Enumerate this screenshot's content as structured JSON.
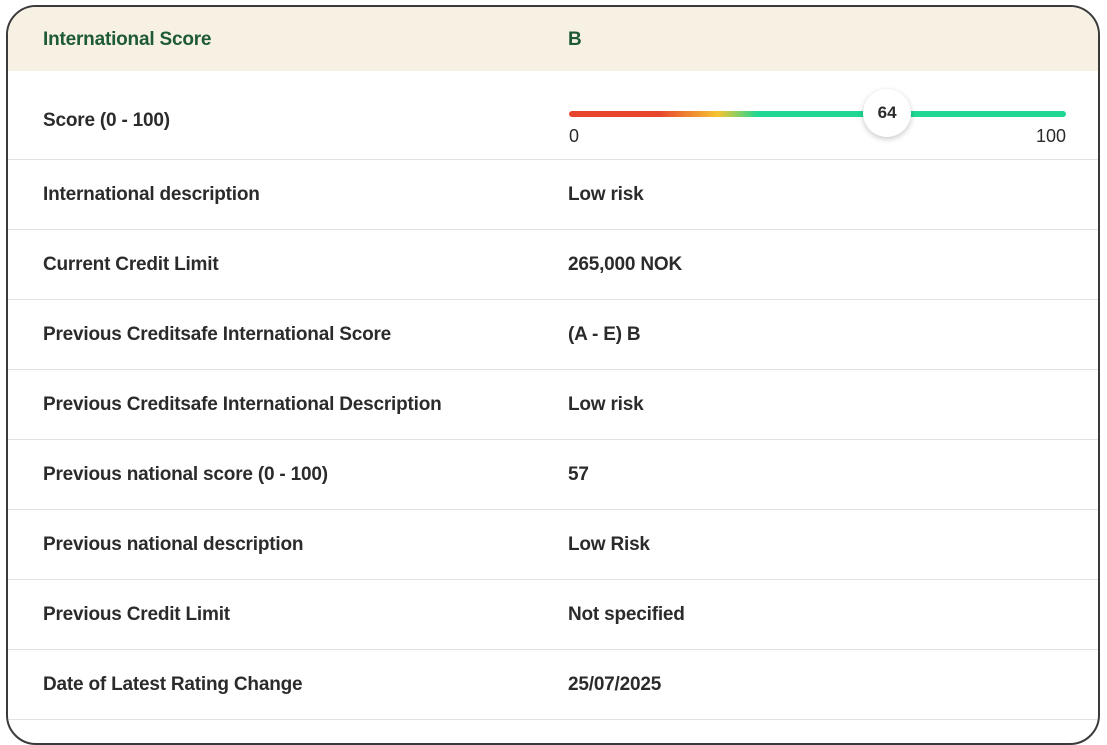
{
  "header": {
    "label": "International Score",
    "value": "B"
  },
  "score": {
    "label": "Score (0 - 100)",
    "value": 64,
    "value_text": "64",
    "min_label": "0",
    "max_label": "100",
    "min": 0,
    "max": 100,
    "gradient_colors": [
      "#e8452f",
      "#f5c431",
      "#1ed893"
    ]
  },
  "rows": [
    {
      "label": "International description",
      "value": "Low risk"
    },
    {
      "label": "Current Credit Limit",
      "value": "265,000 NOK"
    },
    {
      "label": "Previous Creditsafe International Score",
      "value": "(A - E) B"
    },
    {
      "label": "Previous Creditsafe International Description",
      "value": "Low risk"
    },
    {
      "label": "Previous national score (0 - 100)",
      "value": "57"
    },
    {
      "label": "Previous national description",
      "value": "Low Risk"
    },
    {
      "label": "Previous Credit Limit",
      "value": "Not specified"
    },
    {
      "label": "Date of Latest Rating Change",
      "value": "25/07/2025"
    }
  ],
  "colors": {
    "header_background": "#f7f1e3",
    "header_text": "#1d5a35",
    "text": "#2b2b2b",
    "border": "#3a3a3a"
  }
}
